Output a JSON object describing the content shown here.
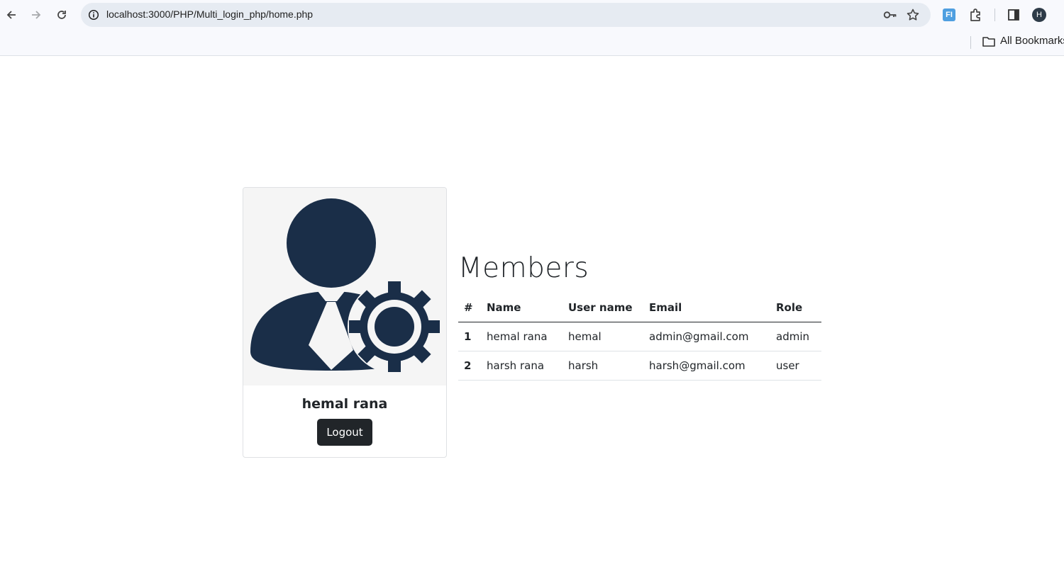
{
  "browser": {
    "url": "localhost:3000/PHP/Multi_login_php/home.php",
    "extension_label": "FI",
    "profile_initial": "H",
    "bookmarks_label": "All Bookmarks"
  },
  "profile": {
    "name": "hemal rana",
    "logout_label": "Logout",
    "avatar_icon": "user-admin-gear-icon"
  },
  "members": {
    "title": "Members",
    "columns": [
      "#",
      "Name",
      "User name",
      "Email",
      "Role"
    ],
    "rows": [
      [
        "1",
        "hemal rana",
        "hemal",
        "admin@gmail.com",
        "admin"
      ],
      [
        "2",
        "harsh rana",
        "harsh",
        "harsh@gmail.com",
        "user"
      ]
    ]
  },
  "colors": {
    "avatar": "#1a2e48",
    "avatar_bg": "#f5f5f5",
    "button_dark": "#212529"
  }
}
